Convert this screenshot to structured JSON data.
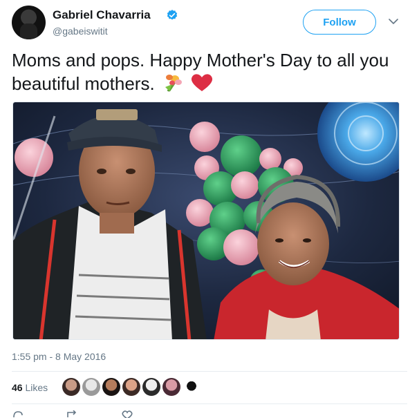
{
  "user": {
    "name": "Gabriel Chavarria",
    "handle": "@gabeiswitit"
  },
  "follow_button": {
    "label": "Follow"
  },
  "tweet": {
    "text": "Moms and pops. Happy Mother's Day to all you beautiful mothers.",
    "emojis": [
      "bouquet-icon",
      "red-heart-icon"
    ]
  },
  "timestamp": "1:55 pm - 8 May 2016",
  "likes": {
    "count": "46",
    "label": "Likes"
  },
  "colors": {
    "accent": "#1da1f2",
    "secondary_text": "#657786",
    "divider": "#e6ecf0"
  }
}
